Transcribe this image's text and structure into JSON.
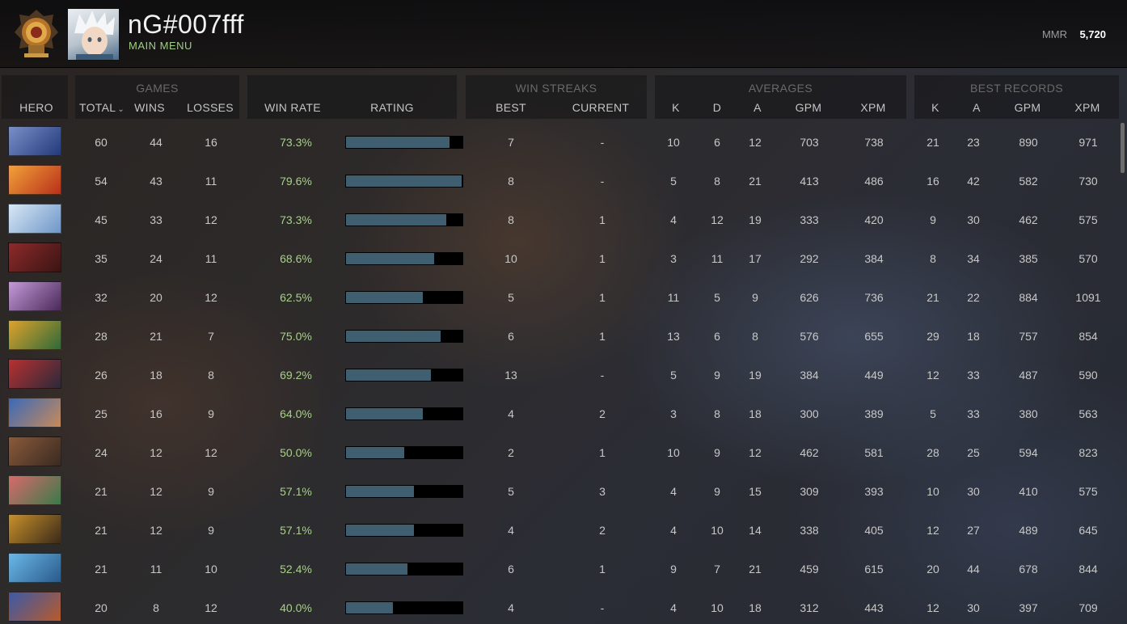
{
  "header": {
    "player_name": "nG#007fff",
    "menu_label": "MAIN MENU",
    "mmr_label": "MMR",
    "mmr_value": "5,720"
  },
  "table": {
    "groups": {
      "games": "GAMES",
      "win_streaks": "WIN STREAKS",
      "averages": "AVERAGES",
      "best_records": "BEST RECORDS"
    },
    "columns": {
      "hero": "HERO",
      "total": "TOTAL",
      "wins": "WINS",
      "losses": "LOSSES",
      "win_rate": "WIN RATE",
      "rating": "RATING",
      "best": "BEST",
      "current": "CURRENT",
      "avg_k": "K",
      "avg_d": "D",
      "avg_a": "A",
      "avg_gpm": "GPM",
      "avg_xpm": "XPM",
      "best_k": "K",
      "best_a": "A",
      "best_gpm": "GPM",
      "best_xpm": "XPM"
    },
    "rows": [
      {
        "total": "60",
        "wins": "44",
        "losses": "16",
        "win_rate": "73.3%",
        "rating": 0.89,
        "best_streak": "7",
        "current_streak": "-",
        "avg_k": "10",
        "avg_d": "6",
        "avg_a": "12",
        "avg_gpm": "703",
        "avg_xpm": "738",
        "best_k": "21",
        "best_a": "23",
        "best_gpm": "890",
        "best_xpm": "971",
        "hero_colors": [
          "#7a8fc8",
          "#233a7a"
        ]
      },
      {
        "total": "54",
        "wins": "43",
        "losses": "11",
        "win_rate": "79.6%",
        "rating": 0.99,
        "best_streak": "8",
        "current_streak": "-",
        "avg_k": "5",
        "avg_d": "8",
        "avg_a": "21",
        "avg_gpm": "413",
        "avg_xpm": "486",
        "best_k": "16",
        "best_a": "42",
        "best_gpm": "582",
        "best_xpm": "730",
        "hero_colors": [
          "#f2a13a",
          "#b8301a"
        ]
      },
      {
        "total": "45",
        "wins": "33",
        "losses": "12",
        "win_rate": "73.3%",
        "rating": 0.86,
        "best_streak": "8",
        "current_streak": "1",
        "avg_k": "4",
        "avg_d": "12",
        "avg_a": "19",
        "avg_gpm": "333",
        "avg_xpm": "420",
        "best_k": "9",
        "best_a": "30",
        "best_gpm": "462",
        "best_xpm": "575",
        "hero_colors": [
          "#d9e8f5",
          "#6e96c8"
        ]
      },
      {
        "total": "35",
        "wins": "24",
        "losses": "11",
        "win_rate": "68.6%",
        "rating": 0.76,
        "best_streak": "10",
        "current_streak": "1",
        "avg_k": "3",
        "avg_d": "11",
        "avg_a": "17",
        "avg_gpm": "292",
        "avg_xpm": "384",
        "best_k": "8",
        "best_a": "34",
        "best_gpm": "385",
        "best_xpm": "570",
        "hero_colors": [
          "#8e2a2a",
          "#3a1414"
        ]
      },
      {
        "total": "32",
        "wins": "20",
        "losses": "12",
        "win_rate": "62.5%",
        "rating": 0.66,
        "best_streak": "5",
        "current_streak": "1",
        "avg_k": "11",
        "avg_d": "5",
        "avg_a": "9",
        "avg_gpm": "626",
        "avg_xpm": "736",
        "best_k": "21",
        "best_a": "22",
        "best_gpm": "884",
        "best_xpm": "1091",
        "hero_colors": [
          "#c49ad8",
          "#4a2a5a"
        ]
      },
      {
        "total": "28",
        "wins": "21",
        "losses": "7",
        "win_rate": "75.0%",
        "rating": 0.81,
        "best_streak": "6",
        "current_streak": "1",
        "avg_k": "13",
        "avg_d": "6",
        "avg_a": "8",
        "avg_gpm": "576",
        "avg_xpm": "655",
        "best_k": "29",
        "best_a": "18",
        "best_gpm": "757",
        "best_xpm": "854",
        "hero_colors": [
          "#e0a22a",
          "#2f6a3a"
        ]
      },
      {
        "total": "26",
        "wins": "18",
        "losses": "8",
        "win_rate": "69.2%",
        "rating": 0.73,
        "best_streak": "13",
        "current_streak": "-",
        "avg_k": "5",
        "avg_d": "9",
        "avg_a": "19",
        "avg_gpm": "384",
        "avg_xpm": "449",
        "best_k": "12",
        "best_a": "33",
        "best_gpm": "487",
        "best_xpm": "590",
        "hero_colors": [
          "#b83030",
          "#2a2a3a"
        ]
      },
      {
        "total": "25",
        "wins": "16",
        "losses": "9",
        "win_rate": "64.0%",
        "rating": 0.66,
        "best_streak": "4",
        "current_streak": "2",
        "avg_k": "3",
        "avg_d": "8",
        "avg_a": "18",
        "avg_gpm": "300",
        "avg_xpm": "389",
        "best_k": "5",
        "best_a": "33",
        "best_gpm": "380",
        "best_xpm": "563",
        "hero_colors": [
          "#3a6ab8",
          "#c88a5a"
        ]
      },
      {
        "total": "24",
        "wins": "12",
        "losses": "12",
        "win_rate": "50.0%",
        "rating": 0.5,
        "best_streak": "2",
        "current_streak": "1",
        "avg_k": "10",
        "avg_d": "9",
        "avg_a": "12",
        "avg_gpm": "462",
        "avg_xpm": "581",
        "best_k": "28",
        "best_a": "25",
        "best_gpm": "594",
        "best_xpm": "823",
        "hero_colors": [
          "#8a5a3a",
          "#3a2a22"
        ]
      },
      {
        "total": "21",
        "wins": "12",
        "losses": "9",
        "win_rate": "57.1%",
        "rating": 0.58,
        "best_streak": "5",
        "current_streak": "3",
        "avg_k": "4",
        "avg_d": "9",
        "avg_a": "15",
        "avg_gpm": "309",
        "avg_xpm": "393",
        "best_k": "10",
        "best_a": "30",
        "best_gpm": "410",
        "best_xpm": "575",
        "hero_colors": [
          "#d86a6a",
          "#3a7a4a"
        ]
      },
      {
        "total": "21",
        "wins": "12",
        "losses": "9",
        "win_rate": "57.1%",
        "rating": 0.58,
        "best_streak": "4",
        "current_streak": "2",
        "avg_k": "4",
        "avg_d": "10",
        "avg_a": "14",
        "avg_gpm": "338",
        "avg_xpm": "405",
        "best_k": "12",
        "best_a": "27",
        "best_gpm": "489",
        "best_xpm": "645",
        "hero_colors": [
          "#c8902a",
          "#3a2a1a"
        ]
      },
      {
        "total": "21",
        "wins": "11",
        "losses": "10",
        "win_rate": "52.4%",
        "rating": 0.53,
        "best_streak": "6",
        "current_streak": "1",
        "avg_k": "9",
        "avg_d": "7",
        "avg_a": "21",
        "avg_gpm": "459",
        "avg_xpm": "615",
        "best_k": "20",
        "best_a": "44",
        "best_gpm": "678",
        "best_xpm": "844",
        "hero_colors": [
          "#6ab8e8",
          "#2a5a8a"
        ]
      },
      {
        "total": "20",
        "wins": "8",
        "losses": "12",
        "win_rate": "40.0%",
        "rating": 0.4,
        "best_streak": "4",
        "current_streak": "-",
        "avg_k": "4",
        "avg_d": "10",
        "avg_a": "18",
        "avg_gpm": "312",
        "avg_xpm": "443",
        "best_k": "12",
        "best_a": "30",
        "best_gpm": "397",
        "best_xpm": "709",
        "hero_colors": [
          "#3a5aa8",
          "#b85a2a"
        ]
      }
    ]
  },
  "colors": {
    "accent_green": "#9fce84",
    "win_rate_green": "#a8d08a",
    "rating_fill": "#3f5f70"
  }
}
